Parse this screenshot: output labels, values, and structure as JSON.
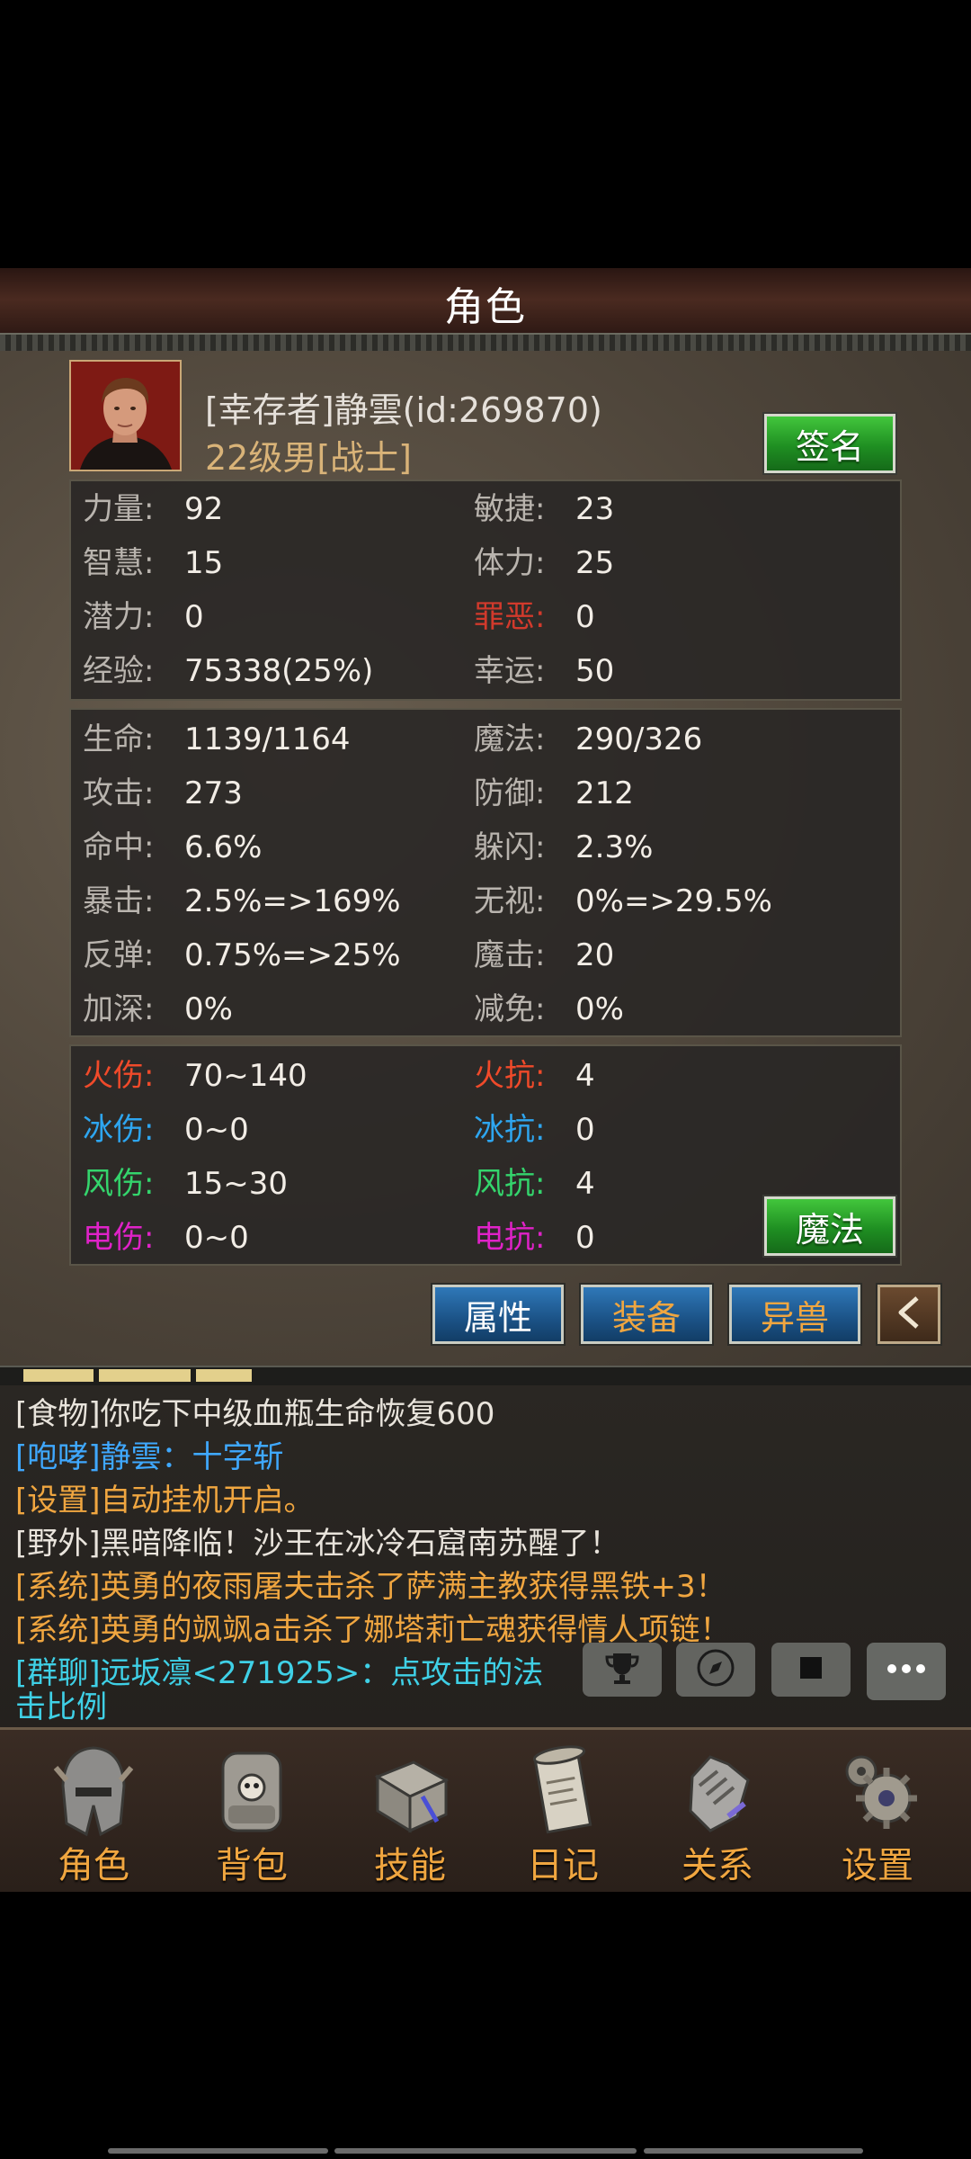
{
  "header": {
    "title": "角色"
  },
  "player": {
    "name": "[幸存者]静雲(id:269870)",
    "subtitle": "22级男[战士]",
    "sign_button": "签名"
  },
  "attributes": [
    {
      "label": "力量:",
      "value": "92"
    },
    {
      "label": "敏捷:",
      "value": "23"
    },
    {
      "label": "智慧:",
      "value": "15"
    },
    {
      "label": "体力:",
      "value": "25"
    },
    {
      "label": "潜力:",
      "value": "0"
    },
    {
      "label": "罪恶:",
      "value": "0"
    },
    {
      "label": "经验:",
      "value": "75338(25%)"
    },
    {
      "label": "幸运:",
      "value": "50"
    }
  ],
  "combat": [
    {
      "label": "生命:",
      "value": "1139/1164"
    },
    {
      "label": "魔法:",
      "value": "290/326"
    },
    {
      "label": "攻击:",
      "value": "273"
    },
    {
      "label": "防御:",
      "value": "212"
    },
    {
      "label": "命中:",
      "value": "6.6%"
    },
    {
      "label": "躲闪:",
      "value": "2.3%"
    },
    {
      "label": "暴击:",
      "value": "2.5%=>169%"
    },
    {
      "label": "无视:",
      "value": "0%=>29.5%"
    },
    {
      "label": "反弹:",
      "value": "0.75%=>25%"
    },
    {
      "label": "魔击:",
      "value": "20"
    },
    {
      "label": "加深:",
      "value": "0%"
    },
    {
      "label": "减免:",
      "value": "0%"
    }
  ],
  "elements": [
    {
      "label": "火伤:",
      "value": "70~140"
    },
    {
      "label": "火抗:",
      "value": "4"
    },
    {
      "label": "冰伤:",
      "value": "0~0"
    },
    {
      "label": "冰抗:",
      "value": "0"
    },
    {
      "label": "风伤:",
      "value": "15~30"
    },
    {
      "label": "风抗:",
      "value": "4"
    },
    {
      "label": "电伤:",
      "value": "0~0"
    },
    {
      "label": "电抗:",
      "value": "0"
    }
  ],
  "magic_button": "魔法",
  "tabs": [
    {
      "label": "属性",
      "active": true
    },
    {
      "label": "装备",
      "active": false
    },
    {
      "label": "异兽",
      "active": false
    }
  ],
  "chat": [
    {
      "text": "[食物]你吃下中级血瓶生命恢复600",
      "color": "#e9e4dc"
    },
    {
      "text": "[咆哮]静雲：十字斩",
      "color": "#3fa8ff"
    },
    {
      "text": "[设置]自动挂机开启。",
      "color": "#f0a640"
    },
    {
      "text": "[野外]黑暗降临！沙王在冰冷石窟南苏醒了！",
      "color": "#e9e4dc"
    },
    {
      "text": "[系统]英勇的夜雨屠夫击杀了萨满主教获得黑铁+3！",
      "color": "#f0a640"
    },
    {
      "text": "[系统]英勇的飒飒a击杀了娜塔莉亡魂获得情人项链！",
      "color": "#f0a640"
    },
    {
      "text": "[群聊]远坂凛<271925>：点攻击的法",
      "color": "#3fd0e6"
    },
    {
      "text": "击比例",
      "color": "#3fd0e6"
    }
  ],
  "chat_icons": [
    "trophy-icon",
    "compass-icon",
    "stop-icon",
    "chat-bubble-icon"
  ],
  "nav": [
    {
      "label": "角色",
      "icon": "helmet-icon"
    },
    {
      "label": "背包",
      "icon": "backpack-icon"
    },
    {
      "label": "技能",
      "icon": "skill-book-icon"
    },
    {
      "label": "日记",
      "icon": "scroll-icon"
    },
    {
      "label": "关系",
      "icon": "gauntlet-icon"
    },
    {
      "label": "设置",
      "icon": "gear-icon"
    }
  ]
}
